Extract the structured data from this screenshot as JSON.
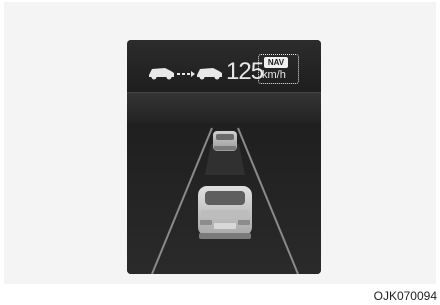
{
  "cluster": {
    "set_speed": "125",
    "speed_unit": "km/h",
    "nav_badge": "NAV"
  },
  "icons": {
    "lead_car": "car-side-icon",
    "distance": "distance-dashes-icon",
    "own_car": "car-side-icon"
  },
  "image_code": "OJK070094",
  "colors": {
    "screen": "#1b1b1b",
    "text": "#e8e8e8",
    "frame": "#f4f4f4"
  }
}
